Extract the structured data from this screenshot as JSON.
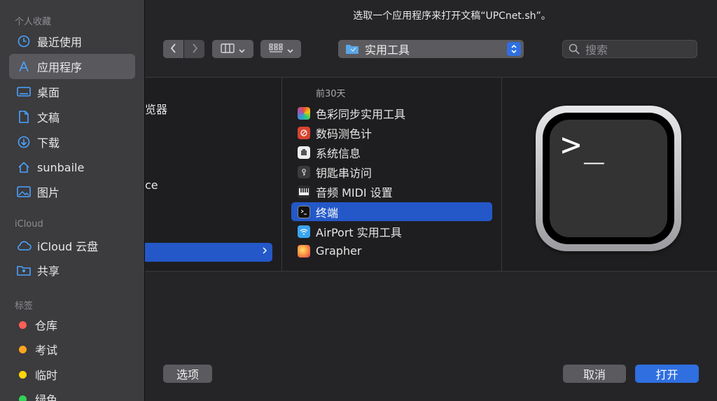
{
  "dialog": {
    "title": "选取一个应用程序来打开文稿“UPCnet.sh”。"
  },
  "sidebar": {
    "favorites_label": "个人收藏",
    "favorites": [
      {
        "label": "最近使用",
        "icon": "clock-icon"
      },
      {
        "label": "应用程序",
        "icon": "applications-icon",
        "selected": true
      },
      {
        "label": "桌面",
        "icon": "desktop-icon"
      },
      {
        "label": "文稿",
        "icon": "document-icon"
      },
      {
        "label": "下载",
        "icon": "download-icon"
      },
      {
        "label": "sunbaile",
        "icon": "home-icon"
      },
      {
        "label": "图片",
        "icon": "photos-icon"
      }
    ],
    "icloud_label": "iCloud",
    "icloud": [
      {
        "label": "iCloud 云盘",
        "icon": "cloud-icon"
      },
      {
        "label": "共享",
        "icon": "shared-folder-icon"
      }
    ],
    "tags_label": "标签",
    "tags": [
      {
        "label": "仓库",
        "color": "#ff5f57"
      },
      {
        "label": "考试",
        "color": "#ffa520"
      },
      {
        "label": "临时",
        "color": "#ffd60a"
      },
      {
        "label": "绿色",
        "color": "#31d158"
      }
    ]
  },
  "toolbar": {
    "back_icon": "chevron-left-icon",
    "forward_icon": "chevron-right-icon",
    "view_icon": "columns-view-icon",
    "group_icon": "grid-group-icon",
    "path_label": "实用工具",
    "search_placeholder": "搜索"
  },
  "browser": {
    "col1_partial": {
      "row1": "览器",
      "row2": "ce"
    },
    "col2_header": "前30天",
    "apps": [
      {
        "label": "色彩同步实用工具",
        "icon": "colorsync-icon",
        "color": "#e0533d"
      },
      {
        "label": "数码测色计",
        "icon": "digital-color-meter-icon",
        "color": "#d8432f"
      },
      {
        "label": "系统信息",
        "icon": "system-information-icon",
        "color": "#ededed"
      },
      {
        "label": "钥匙串访问",
        "icon": "keychain-icon",
        "color": "#444"
      },
      {
        "label": "音频 MIDI 设置",
        "icon": "audio-midi-icon",
        "color": "#333"
      },
      {
        "label": "终端",
        "icon": "terminal-icon",
        "color": "#111",
        "selected": true
      },
      {
        "label": "AirPort 实用工具",
        "icon": "airport-icon",
        "color": "#3aa4f0"
      },
      {
        "label": "Grapher",
        "icon": "grapher-icon",
        "color": "#f7b733"
      }
    ],
    "preview_icon": "terminal-large-icon",
    "preview_prompt": ">_"
  },
  "footer": {
    "options_label": "选项",
    "cancel_label": "取消",
    "open_label": "打开"
  }
}
